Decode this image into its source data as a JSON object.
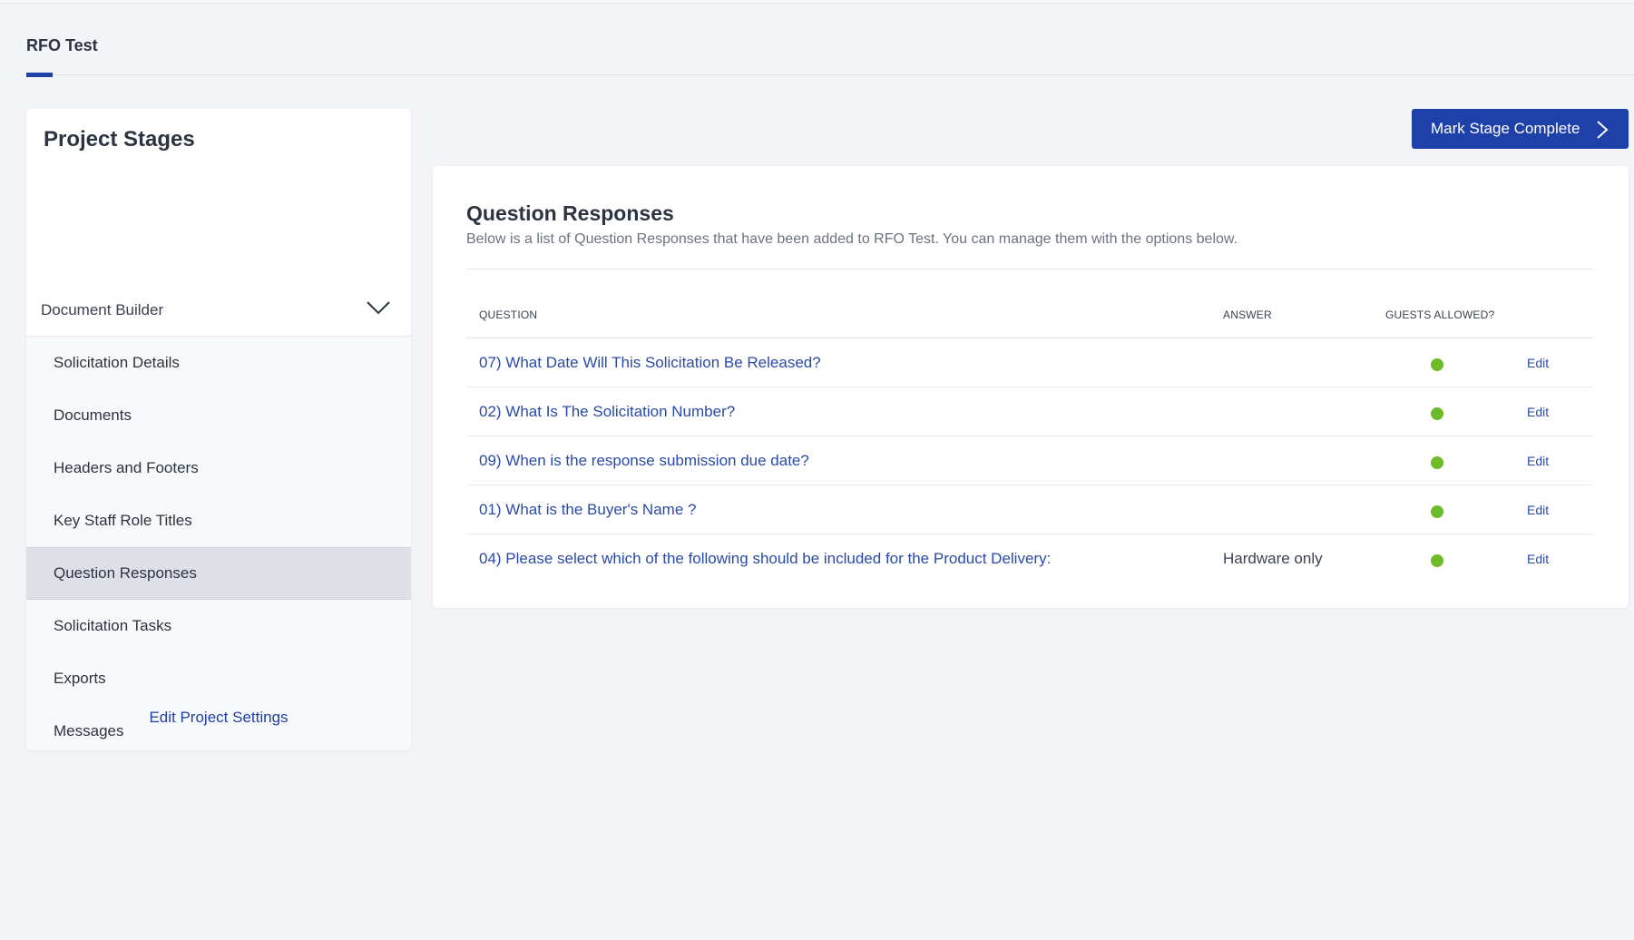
{
  "project": {
    "tab_label": "RFO Test"
  },
  "sidebar": {
    "title": "Project Stages",
    "stage_header": "Document Builder",
    "items": [
      {
        "label": "Solicitation Details",
        "active": false
      },
      {
        "label": "Documents",
        "active": false
      },
      {
        "label": "Headers and Footers",
        "active": false
      },
      {
        "label": "Key Staff Role Titles",
        "active": false
      },
      {
        "label": "Question Responses",
        "active": true
      },
      {
        "label": "Solicitation Tasks",
        "active": false
      },
      {
        "label": "Exports",
        "active": false
      },
      {
        "label": "Messages",
        "active": false
      }
    ],
    "edit_settings_label": "Edit Project Settings"
  },
  "actions": {
    "mark_stage_complete": "Mark Stage Complete"
  },
  "main": {
    "title": "Question Responses",
    "subtitle": "Below is a list of Question Responses that have been added to RFO Test. You can manage them with the options below.",
    "columns": {
      "question": "QUESTION",
      "answer": "ANSWER",
      "guests": "GUESTS ALLOWED?"
    },
    "rows": [
      {
        "question": "07) What Date Will This Solicitation Be Released?",
        "answer": "",
        "guests_allowed": true,
        "edit": "Edit"
      },
      {
        "question": "02) What Is The Solicitation Number?",
        "answer": "",
        "guests_allowed": true,
        "edit": "Edit"
      },
      {
        "question": "09) When is the response submission due date?",
        "answer": "",
        "guests_allowed": true,
        "edit": "Edit"
      },
      {
        "question": "01) What is the Buyer's Name ?",
        "answer": "",
        "guests_allowed": true,
        "edit": "Edit"
      },
      {
        "question": "04) Please select which of the following should be included for the Product Delivery:",
        "answer": "Hardware only",
        "guests_allowed": true,
        "edit": "Edit"
      }
    ]
  },
  "colors": {
    "accent": "#1e40a9",
    "link": "#2a4aa8",
    "status_green": "#6dbb2b"
  }
}
